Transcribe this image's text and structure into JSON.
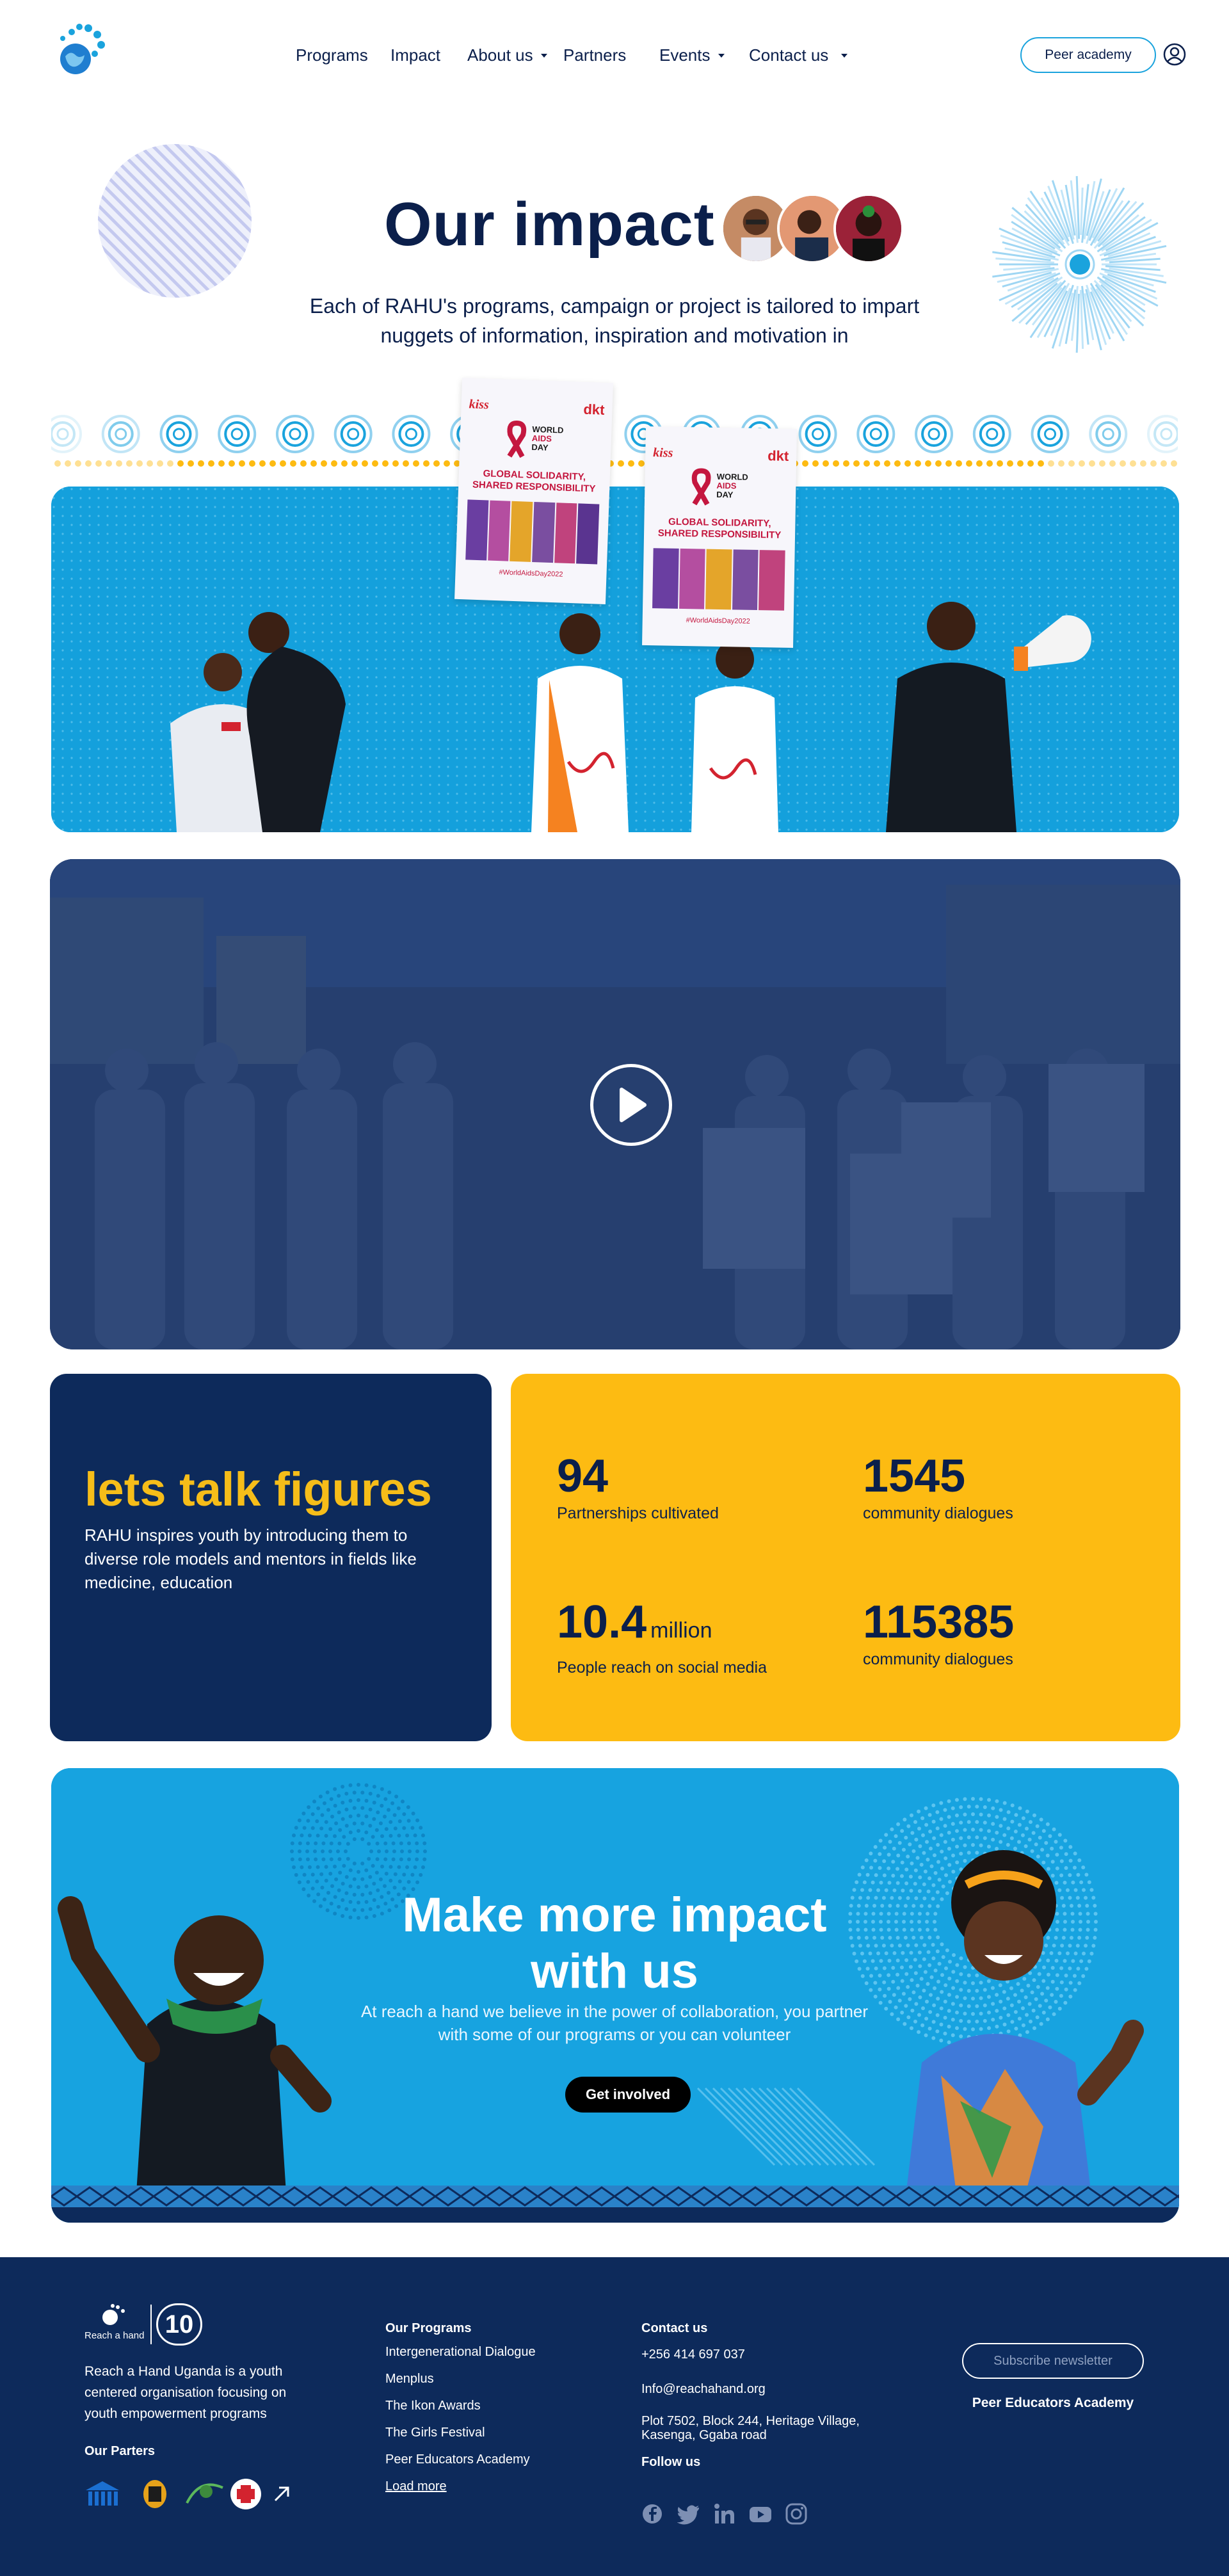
{
  "header": {
    "nav": [
      {
        "label": "Programs",
        "has_dropdown": false
      },
      {
        "label": "Impact",
        "has_dropdown": false
      },
      {
        "label": "About us",
        "has_dropdown": true
      },
      {
        "label": "Partners",
        "has_dropdown": false
      },
      {
        "label": "Events",
        "has_dropdown": true
      },
      {
        "label": "Contact us",
        "has_dropdown": true
      }
    ],
    "peer_button": "Peer academy",
    "user_icon": "user-circle-icon",
    "logo_icon": "hand-globe-icon"
  },
  "hero": {
    "title": "Our impact",
    "subtitle": "Each of RAHU's programs, campaign or project is tailored to impart nuggets of information, inspiration and motivation in"
  },
  "banner": {
    "placard_lines": [
      "WORLD",
      "AIDS",
      "DAY",
      "GLOBAL SOLIDARITY,",
      "SHARED RESPONSIBILITY",
      "#WorldAidsDay2022"
    ],
    "placard_brand_left": "kiss",
    "placard_brand_right": "dkt"
  },
  "video": {
    "play_icon": "play-icon"
  },
  "figures": {
    "title": "lets talk figures",
    "text": "RAHU inspires youth by introducing them to diverse role models and mentors in fields like medicine, education",
    "stats": [
      {
        "value": "94",
        "unit": "",
        "label": "Partnerships cultivated"
      },
      {
        "value": "1545",
        "unit": "",
        "label": "community dialogues"
      },
      {
        "value": "10.4",
        "unit": "million",
        "label": "People reach on social media"
      },
      {
        "value": "115385",
        "unit": "",
        "label": "community dialogues"
      }
    ]
  },
  "cta": {
    "title": "Make more impact with us",
    "text": "At reach a hand we believe in the power of collaboration, you partner with some of our programs or you can volunteer",
    "button": "Get involved"
  },
  "footer": {
    "logo_text": "Reach a hand",
    "logo_anniversary": "10",
    "description": "Reach a Hand Uganda is a youth centered organisation focusing on youth empowerment programs",
    "partners_heading": "Our Parters",
    "programs_heading": "Our Programs",
    "programs": [
      "Intergenerational Dialogue",
      "Menplus",
      "The Ikon Awards",
      "The Girls Festival",
      "Peer Educators Academy"
    ],
    "load_more": "Load more",
    "contact_heading": "Contact us",
    "phone": "+256 414 697 037",
    "email": "Info@reachahand.org",
    "address": "Plot 7502, Block 244, Heritage Village, Kasenga, Ggaba road",
    "follow_heading": "Follow us",
    "socials": [
      "facebook-icon",
      "twitter-icon",
      "linkedin-icon",
      "youtube-icon",
      "instagram-icon"
    ],
    "subscribe": "Subscribe newsletter",
    "peer_link": "Peer Educators Academy"
  },
  "colors": {
    "navy": "#0b1f4b",
    "footer_navy": "#0d2a5b",
    "accent_blue": "#17a3e0",
    "accent_yellow": "#fdbb12"
  }
}
